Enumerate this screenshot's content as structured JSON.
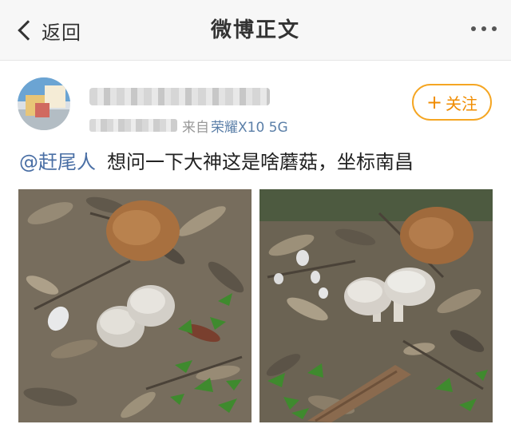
{
  "nav": {
    "back_label": "返回",
    "title": "微博正文"
  },
  "post": {
    "source_prefix": "来自",
    "device": "荣耀X10 5G",
    "follow_label": "关注",
    "mention": "@赶尾人",
    "text": "想问一下大神这是啥蘑菇，坐标南昌"
  },
  "colors": {
    "link_blue": "#4a6fa5",
    "follow_orange": "#f08c00",
    "nav_bg": "#f7f7f7"
  },
  "icons": {
    "back": "chevron-left-icon",
    "more": "more-dots-icon",
    "follow": "plus-icon"
  }
}
